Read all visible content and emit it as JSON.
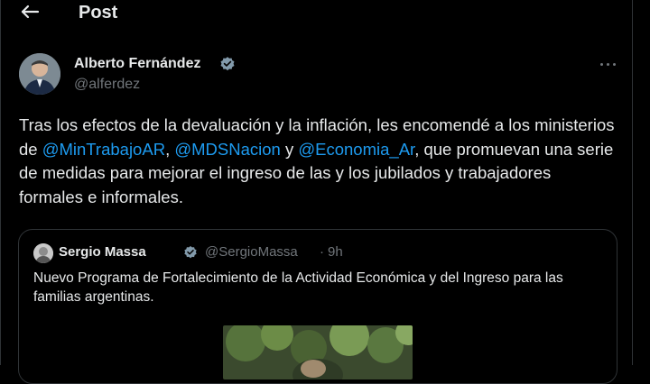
{
  "header": {
    "back_icon": "arrow-left-icon",
    "title": "Post"
  },
  "author": {
    "name": "Alberto Fernández",
    "handle": "@alferdez",
    "verified_color": "#829aab"
  },
  "tweet": {
    "text_1": "Tras los efectos de la devaluación y la inflación, les encomendé a los ministerios de ",
    "mention_1": "@MinTrabajoAR",
    "sep_1": ", ",
    "mention_2": "@MDSNacion",
    "sep_2": " y ",
    "mention_3": "@Economia_Ar",
    "text_2": ", que promuevan una serie de medidas para mejorar el ingreso de las y los jubilados y trabajadores formales e informales.",
    "mention_color": "#1d9bf0"
  },
  "quote": {
    "name": "Sergio Massa",
    "handle": "@SergioMassa",
    "dot": "·",
    "time": "9h",
    "text": "Nuevo Programa de Fortalecimiento de la Actividad Económica y del Ingreso para las familias argentinas."
  },
  "colors": {
    "background": "#000000",
    "text_primary": "#e7e9ea",
    "text_secondary": "#71767b",
    "border": "#2f3336"
  }
}
